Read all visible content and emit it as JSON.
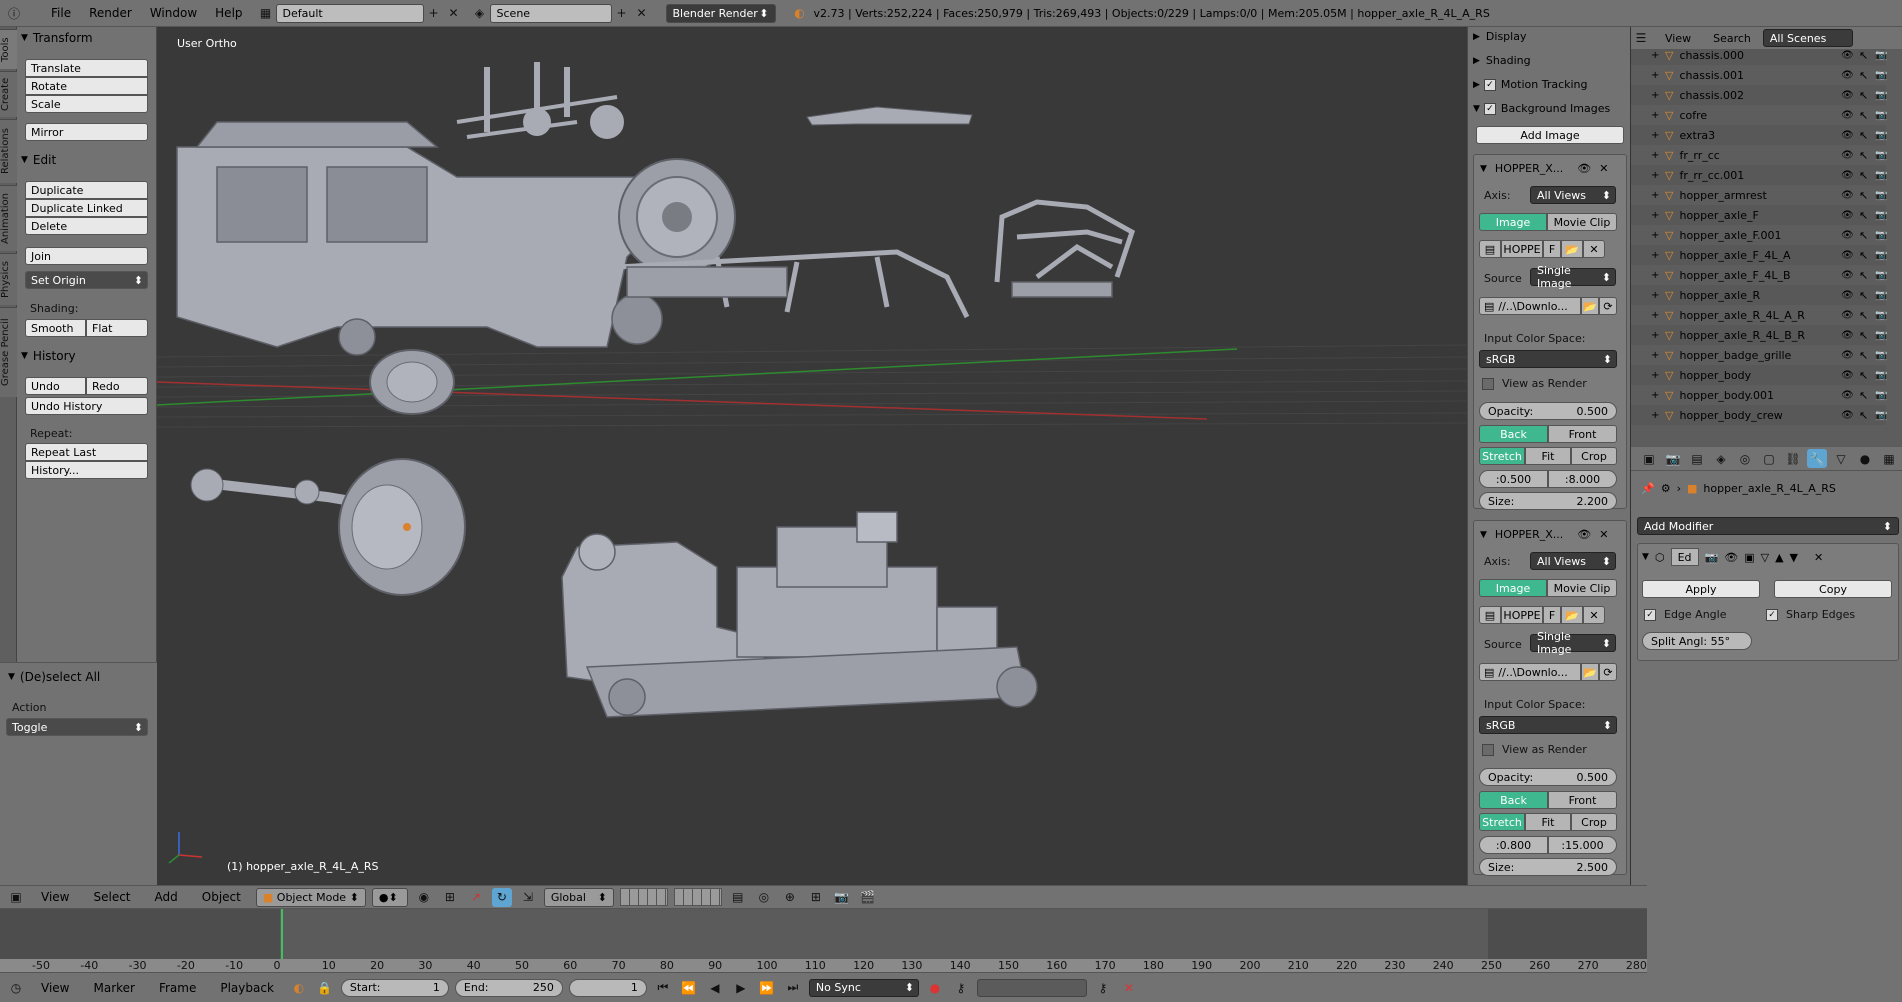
{
  "topbar": {
    "menus": [
      "File",
      "Render",
      "Window",
      "Help"
    ],
    "screen_layout": "Default",
    "scene": "Scene",
    "render_engine": "Blender Render",
    "stats": "v2.73 | Verts:252,224 | Faces:250,979 | Tris:269,493 | Objects:0/229 | Lamps:0/0 | Mem:205.05M | hopper_axle_R_4L_A_RS"
  },
  "tool_tabs": [
    "Tools",
    "Create",
    "Relations",
    "Animation",
    "Physics",
    "Grease Pencil"
  ],
  "toolshelf": {
    "transform_title": "Transform",
    "translate": "Translate",
    "rotate": "Rotate",
    "scale": "Scale",
    "mirror": "Mirror",
    "edit_title": "Edit",
    "duplicate": "Duplicate",
    "duplicate_linked": "Duplicate Linked",
    "delete": "Delete",
    "join": "Join",
    "set_origin": "Set Origin",
    "shading_label": "Shading:",
    "smooth": "Smooth",
    "flat": "Flat",
    "history_title": "History",
    "undo": "Undo",
    "redo": "Redo",
    "undo_history": "Undo History",
    "repeat_label": "Repeat:",
    "repeat_last": "Repeat Last",
    "history_btn": "History...",
    "operator_title": "(De)select All",
    "action_label": "Action",
    "action_value": "Toggle"
  },
  "viewport": {
    "view_name": "User Ortho",
    "active_object": "(1) hopper_axle_R_4L_A_RS"
  },
  "npanel": {
    "display": "Display",
    "shading": "Shading",
    "motion_tracking": "Motion Tracking",
    "background_images": "Background Images",
    "add_image": "Add Image",
    "images": [
      {
        "name": "HOPPER_X...",
        "axis_label": "Axis:",
        "axis": "All Views",
        "image": "Image",
        "movie_clip": "Movie Clip",
        "img_name": "HOPPE",
        "img_f": "F",
        "source_label": "Source",
        "source": "Single Image",
        "path": "//..\\Downlo...",
        "color_space_label": "Input Color Space:",
        "color_space": "sRGB",
        "view_as_render": "View as Render",
        "opacity": "Opacity:",
        "opacity_val": "0.500",
        "back": "Back",
        "front": "Front",
        "stretch": "Stretch",
        "fit": "Fit",
        "crop": "Crop",
        "offset_x": "0.500",
        "offset_y": "8.000",
        "size_label": "Size:",
        "size": "2.200"
      },
      {
        "name": "HOPPER_X...",
        "axis_label": "Axis:",
        "axis": "All Views",
        "image": "Image",
        "movie_clip": "Movie Clip",
        "img_name": "HOPPE",
        "img_f": "F",
        "source_label": "Source",
        "source": "Single Image",
        "path": "//..\\Downlo...",
        "color_space_label": "Input Color Space:",
        "color_space": "sRGB",
        "view_as_render": "View as Render",
        "opacity": "Opacity:",
        "opacity_val": "0.500",
        "back": "Back",
        "front": "Front",
        "stretch": "Stretch",
        "fit": "Fit",
        "crop": "Crop",
        "offset_x": "0.800",
        "offset_y": "15.000",
        "size_label": "Size:",
        "size": "2.500"
      }
    ]
  },
  "outliner": {
    "view": "View",
    "search": "Search",
    "filter": "All Scenes",
    "items": [
      "chassis.000",
      "chassis.001",
      "chassis.002",
      "cofre",
      "extra3",
      "fr_rr_cc",
      "fr_rr_cc.001",
      "hopper_armrest",
      "hopper_axle_F",
      "hopper_axle_F.001",
      "hopper_axle_F_4L_A",
      "hopper_axle_F_4L_B",
      "hopper_axle_R",
      "hopper_axle_R_4L_A_R",
      "hopper_axle_R_4L_B_R",
      "hopper_badge_grille",
      "hopper_body",
      "hopper_body.001",
      "hopper_body_crew"
    ]
  },
  "properties": {
    "object_name": "hopper_axle_R_4L_A_RS",
    "add_modifier": "Add Modifier",
    "modifier_name": "Ed",
    "apply": "Apply",
    "copy": "Copy",
    "edge_angle": "Edge Angle",
    "sharp_edges": "Sharp Edges",
    "split_angle": "Split Angl:  55°"
  },
  "viewport_header": {
    "view": "View",
    "select": "Select",
    "add": "Add",
    "object": "Object",
    "mode": "Object Mode",
    "orientation": "Global"
  },
  "timeline": {
    "ticks": [
      "-50",
      "-40",
      "-30",
      "-20",
      "-10",
      "0",
      "10",
      "20",
      "30",
      "40",
      "50",
      "60",
      "70",
      "80",
      "90",
      "100",
      "110",
      "120",
      "130",
      "140",
      "150",
      "160",
      "170",
      "180",
      "190",
      "200",
      "210",
      "220",
      "230",
      "240",
      "250",
      "260",
      "270",
      "280"
    ],
    "view": "View",
    "marker": "Marker",
    "frame": "Frame",
    "playback": "Playback",
    "start_label": "Start:",
    "start": "1",
    "end_label": "End:",
    "end": "250",
    "current": "1",
    "sync": "No Sync"
  },
  "colors": {
    "panel_bg": "#727272",
    "viewport_bg": "#393939",
    "accent_teal": "#3fb88f",
    "selected_blue": "#5ea5d2"
  }
}
